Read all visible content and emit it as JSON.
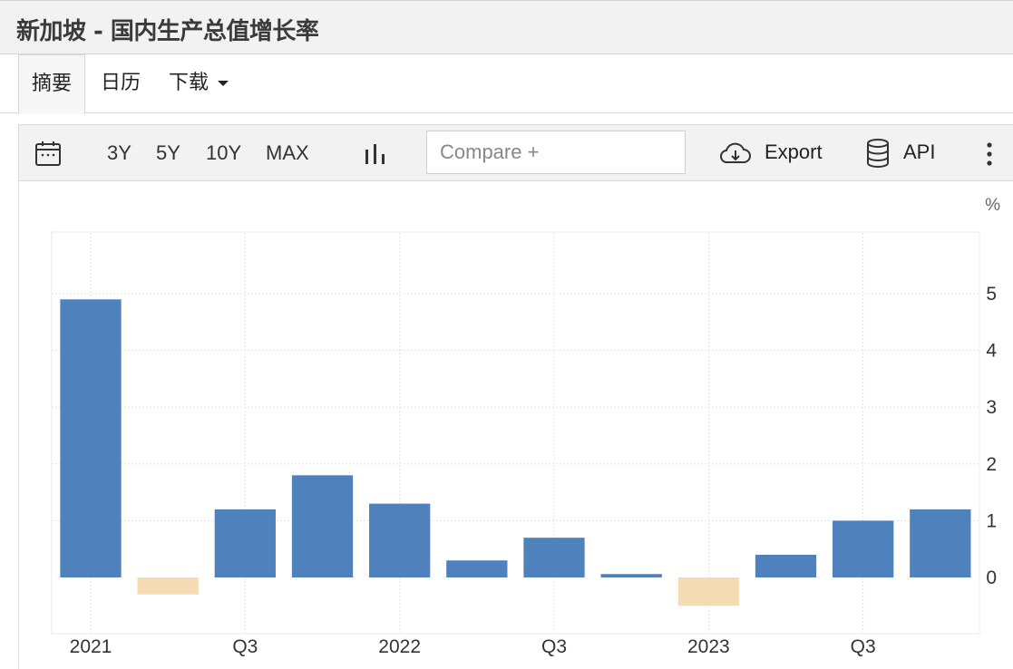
{
  "header": {
    "title": "新加坡 - 国内生产总值增长率"
  },
  "tabs": [
    {
      "label": "摘要",
      "active": true
    },
    {
      "label": "日历",
      "active": false
    },
    {
      "label": "下载",
      "active": false,
      "has_dropdown": true
    }
  ],
  "toolbar": {
    "ranges": [
      "3Y",
      "5Y",
      "10Y",
      "MAX"
    ],
    "compare_placeholder": "Compare +",
    "export_label": "Export",
    "api_label": "API",
    "icons": [
      "calendar-icon",
      "bar-chart-icon",
      "cloud-download-icon",
      "database-icon",
      "more-vertical-icon"
    ]
  },
  "colors": {
    "positive": "#4f81bd",
    "negative": "#f5dbb3",
    "grid": "#e3e3e3"
  },
  "chart_data": {
    "type": "bar",
    "unit": "%",
    "x_tick_labels": [
      "2021",
      "Q3",
      "2022",
      "Q3",
      "2023",
      "Q3"
    ],
    "values": [
      4.9,
      -0.3,
      1.2,
      1.8,
      1.3,
      0.3,
      0.7,
      0.06,
      -0.5,
      0.4,
      1.0,
      1.2
    ],
    "y_ticks": [
      0,
      1,
      2,
      3,
      4,
      5
    ],
    "ylim": [
      -1,
      6
    ],
    "y_axis_side": "right",
    "grid": true
  }
}
